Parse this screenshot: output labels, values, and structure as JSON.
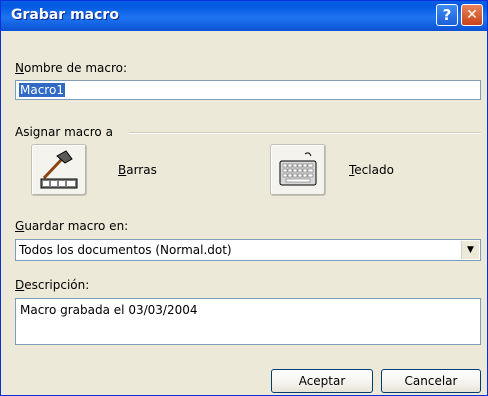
{
  "window": {
    "title": "Grabar macro"
  },
  "icons": {
    "help": "?",
    "close": "✕",
    "dropdown": "▼"
  },
  "macro_name": {
    "label_underline": "N",
    "label_rest": "ombre de macro:",
    "value": "Macro1"
  },
  "assign": {
    "label": "Asignar macro a",
    "bars": {
      "label_underline": "B",
      "label_rest": "arras",
      "icon": "hammer-toolbar-icon"
    },
    "keyboard": {
      "label_underline": "T",
      "label_rest": "eclado",
      "icon": "keyboard-icon"
    }
  },
  "store": {
    "label_underline": "G",
    "label_rest": "uardar macro en:",
    "value": "Todos los documentos (Normal.dot)"
  },
  "description": {
    "label_underline": "D",
    "label_rest": "escripción:",
    "value": "Macro grabada el 03/03/2004"
  },
  "buttons": {
    "ok": "Aceptar",
    "cancel": "Cancelar"
  },
  "colors": {
    "titlebar": "#0a5fe6",
    "dialog_bg": "#ece9d8",
    "selection": "#316ac5"
  }
}
